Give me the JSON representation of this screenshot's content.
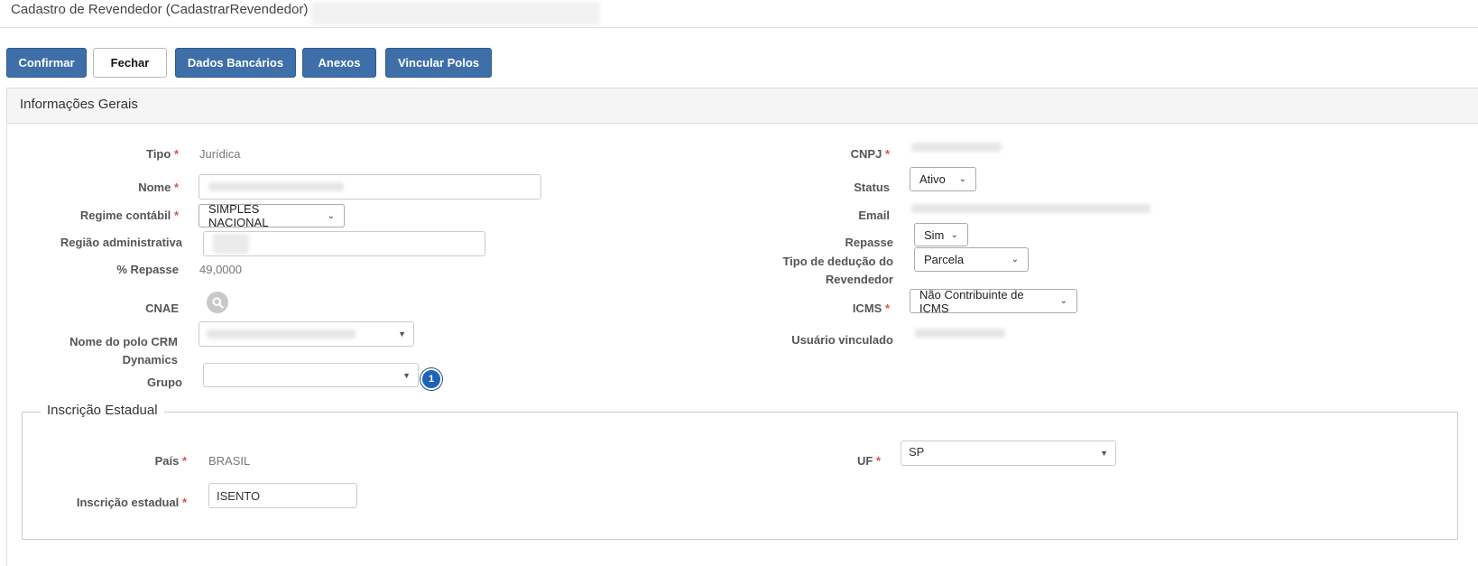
{
  "window": {
    "title": "Cadastro de Revendedor (CadastrarRevendedor)"
  },
  "toolbar": {
    "confirm": "Confirmar",
    "close": "Fechar",
    "bank_data": "Dados Bancários",
    "attachments": "Anexos",
    "link_poles": "Vincular Polos"
  },
  "panel": {
    "title": "Informações Gerais"
  },
  "required_mark": "*",
  "fields": {
    "tipo": {
      "label": "Tipo",
      "value": "Jurídica"
    },
    "nome": {
      "label": "Nome"
    },
    "regime": {
      "label": "Regime contábil",
      "value": "SIMPLES NACIONAL"
    },
    "regiao": {
      "label": "Região administrativa"
    },
    "repasse_pct": {
      "label": "% Repasse",
      "value": "49,0000"
    },
    "cnae": {
      "label": "CNAE"
    },
    "polo": {
      "label": "Nome do polo CRM Dynamics"
    },
    "grupo": {
      "label": "Grupo",
      "value": "",
      "badge": "1"
    },
    "cnpj": {
      "label": "CNPJ"
    },
    "status": {
      "label": "Status",
      "value": "Ativo"
    },
    "email": {
      "label": "Email"
    },
    "repasse": {
      "label": "Repasse",
      "value": "Sim"
    },
    "deducao": {
      "label": "Tipo de dedução do Revendedor",
      "value": "Parcela"
    },
    "icms": {
      "label": "ICMS",
      "value": "Não Contribuinte de ICMS"
    },
    "usuario": {
      "label": "Usuário vinculado"
    }
  },
  "inscricao": {
    "legend": "Inscrição Estadual",
    "pais": {
      "label": "País",
      "value": "BRASIL"
    },
    "uf": {
      "label": "UF",
      "value": "SP"
    },
    "ie": {
      "label": "Inscrição estadual",
      "value": "ISENTO"
    }
  },
  "icons": {
    "search": "search-icon",
    "dropdown": "chevron-down-icon"
  },
  "colors": {
    "primary_button": "#3f6fa8",
    "required": "#d9534f",
    "badge": "#1e63b8"
  }
}
